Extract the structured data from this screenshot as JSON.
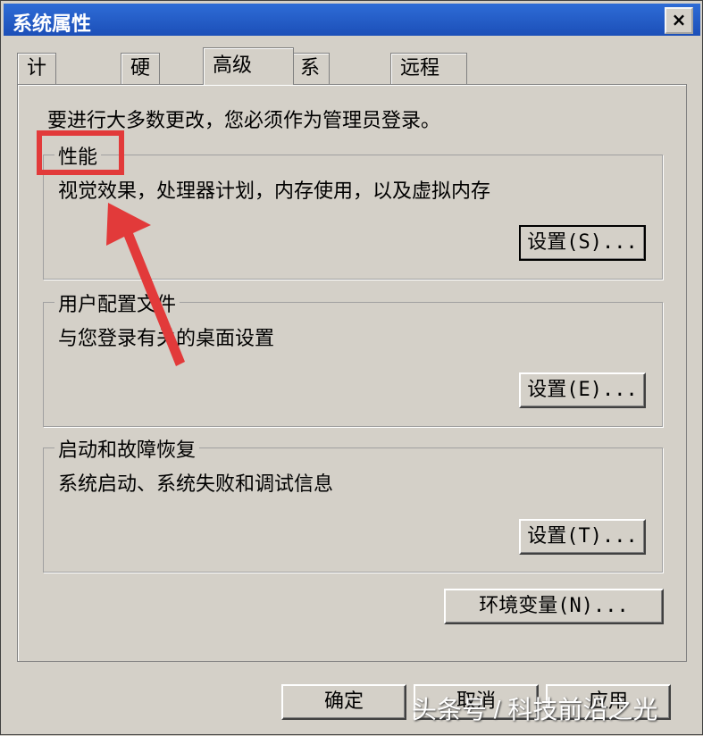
{
  "window": {
    "title": "系统属性",
    "close_glyph": "×"
  },
  "tabs": [
    {
      "label": "计算机名"
    },
    {
      "label": "硬件"
    },
    {
      "label": "高级",
      "active": true
    },
    {
      "label": "系统保护"
    },
    {
      "label": "远程"
    }
  ],
  "admin_note": "要进行大多数更改，您必须作为管理员登录。",
  "groups": {
    "performance": {
      "title": "性能",
      "description": "视觉效果，处理器计划，内存使用，以及虚拟内存",
      "button": "设置(S)..."
    },
    "user_profiles": {
      "title": "用户配置文件",
      "description": "与您登录有关的桌面设置",
      "button": "设置(E)..."
    },
    "startup_recovery": {
      "title": "启动和故障恢复",
      "description": "系统启动、系统失败和调试信息",
      "button": "设置(T)..."
    }
  },
  "env_button": "环境变量(N)...",
  "footer": {
    "ok": "确定",
    "cancel": "取消",
    "apply": "应用"
  },
  "watermark": "头条号 / 科技前沿之光",
  "colors": {
    "highlight": "#e23a3a",
    "titlebar": "#1c4fb8"
  }
}
